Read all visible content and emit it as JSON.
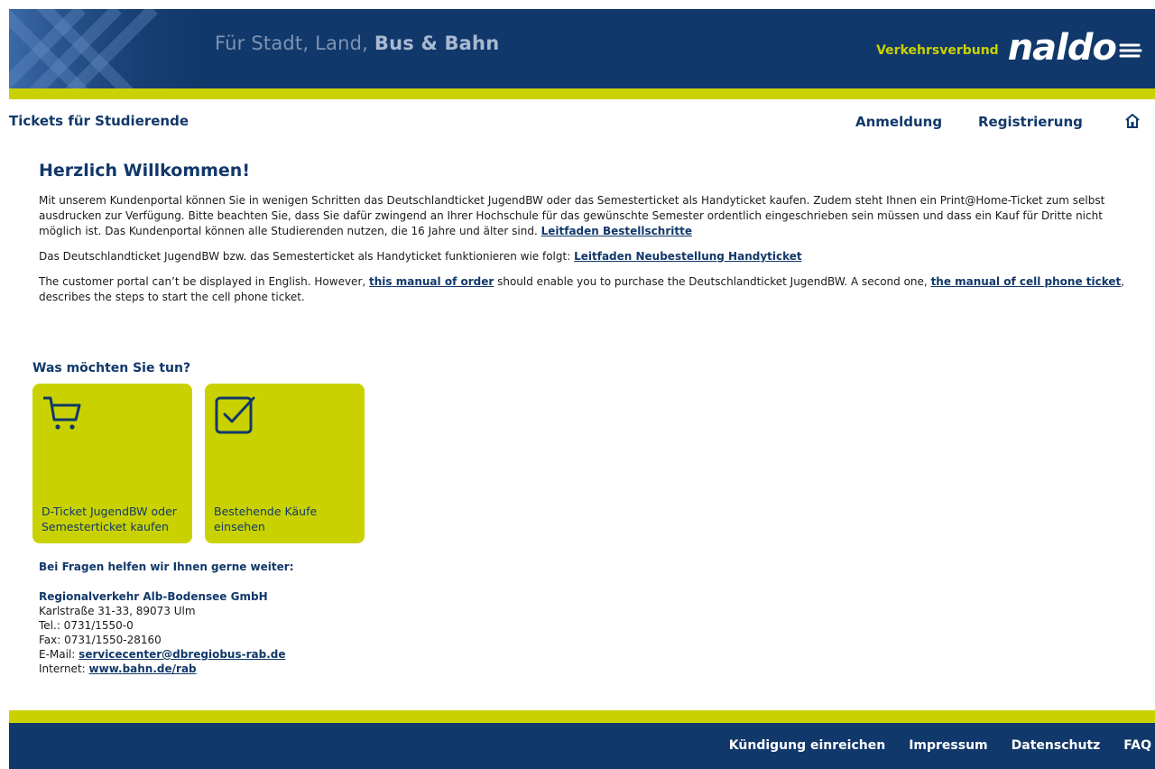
{
  "header": {
    "tagline_light": "Für Stadt, Land,",
    "tagline_bold": "Bus & Bahn",
    "brand_prefix": "Verkehrsverbund",
    "brand_name": "naldo"
  },
  "subnav": {
    "title": "Tickets für Studierende",
    "login": "Anmeldung",
    "register": "Registrierung",
    "home_icon": "home-icon"
  },
  "main": {
    "welcome": "Herzlich Willkommen!",
    "para1_text": "Mit unserem Kundenportal können Sie in wenigen Schritten das Deutschlandticket JugendBW oder das Semesterticket als Handyticket kaufen. Zudem steht Ihnen ein Print@Home-Ticket zum selbst ausdrucken zur Verfügung. Bitte beachten Sie, dass Sie dafür zwingend an Ihrer Hochschule für das gewünschte Semester ordentlich eingeschrieben sein müssen und dass ein Kauf für Dritte nicht möglich ist. Das Kundenportal können alle Studierenden nutzen, die 16 Jahre und älter sind.",
    "para1_link": "Leitfaden Bestellschritte",
    "para2_text": "Das Deutschlandticket JugendBW bzw. das Semesterticket als Handyticket funktionieren wie folgt:",
    "para2_link": "Leitfaden Neubestellung Handyticket",
    "para3_text_a": "The customer portal can’t be displayed in English. However,",
    "para3_link_a": "this manual of order",
    "para3_text_b": "should enable you to purchase the Deutschlandticket JugendBW. A second one,",
    "para3_link_b": "the manual of cell phone ticket",
    "para3_text_c": ", describes the steps to start the cell phone ticket."
  },
  "actions": {
    "title": "Was möchten Sie tun?",
    "tiles": [
      {
        "label": "D-Ticket JugendBW oder Semesterticket kaufen",
        "icon": "cart-icon"
      },
      {
        "label": "Bestehende Käufe einsehen",
        "icon": "checkbox-icon"
      }
    ]
  },
  "contact": {
    "heading": "Bei Fragen helfen wir Ihnen gerne weiter:",
    "company": "Regionalverkehr Alb-Bodensee GmbH",
    "address": "Karlstraße 31-33, 89073 Ulm",
    "tel": "Tel.: 0731/1550-0",
    "fax": "Fax: 0731/1550-28160",
    "email_label": "E-Mail:",
    "email": "servicecenter@dbregiobus-rab.de",
    "internet_label": "Internet:",
    "internet": "www.bahn.de/rab"
  },
  "footer": {
    "links": [
      "Kündigung einreichen",
      "Impressum",
      "Datenschutz",
      "FAQ"
    ]
  },
  "colors": {
    "navy": "#11386a",
    "lime": "#c9d200"
  }
}
